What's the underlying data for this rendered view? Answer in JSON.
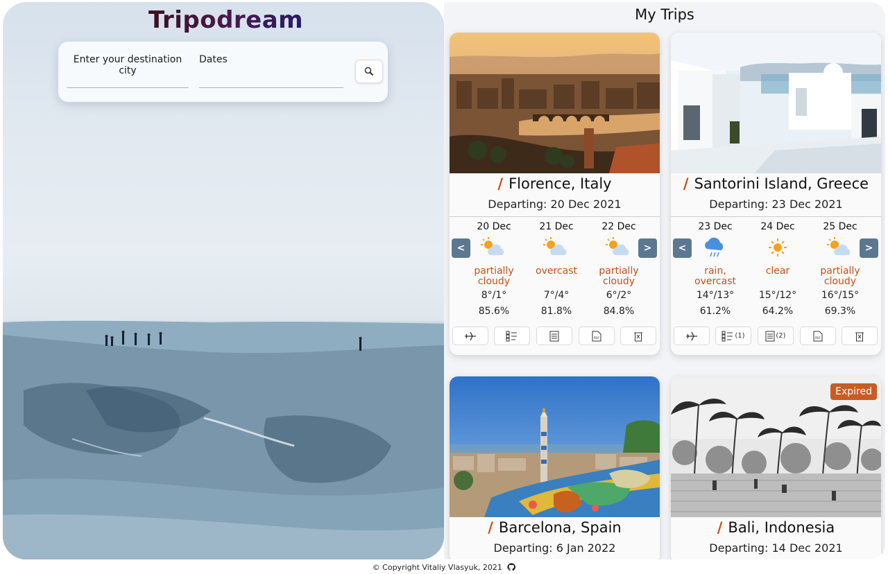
{
  "app": {
    "logo": "Tripodream"
  },
  "search": {
    "destination_label": "Enter your destination city",
    "dates_label": "Dates",
    "search_icon": "magnifier-icon"
  },
  "trips_section": {
    "title": "My Trips"
  },
  "trips": [
    {
      "city": "Florence, Italy",
      "departing": "Departing: 20 Dec 2021",
      "forecast": [
        {
          "date": "20 Dec",
          "icon": "partly-cloudy-icon",
          "condition": "partially cloudy",
          "temp": "8°/1°",
          "humidity": "85.6%"
        },
        {
          "date": "21 Dec",
          "icon": "partly-cloudy-icon",
          "condition": "overcast",
          "temp": "7°/4°",
          "humidity": "81.8%"
        },
        {
          "date": "22 Dec",
          "icon": "partly-cloudy-icon",
          "condition": "partially cloudy",
          "temp": "6°/2°",
          "humidity": "84.8%"
        }
      ],
      "actions": [
        {
          "icon": "plane-icon",
          "count": ""
        },
        {
          "icon": "checklist-icon",
          "count": ""
        },
        {
          "icon": "notes-icon",
          "count": ""
        },
        {
          "icon": "pdf-icon",
          "count": ""
        },
        {
          "icon": "delete-icon",
          "count": ""
        }
      ]
    },
    {
      "city": "Santorini Island, Greece",
      "departing": "Departing: 23 Dec 2021",
      "forecast": [
        {
          "date": "23 Dec",
          "icon": "rain-icon",
          "condition": "rain, overcast",
          "temp": "14°/13°",
          "humidity": "61.2%"
        },
        {
          "date": "24 Dec",
          "icon": "sun-icon",
          "condition": "clear",
          "temp": "15°/12°",
          "humidity": "64.2%"
        },
        {
          "date": "25 Dec",
          "icon": "partly-cloudy-icon",
          "condition": "partially cloudy",
          "temp": "16°/15°",
          "humidity": "69.3%"
        }
      ],
      "actions": [
        {
          "icon": "plane-icon",
          "count": ""
        },
        {
          "icon": "checklist-icon",
          "count": "(1)"
        },
        {
          "icon": "notes-icon",
          "count": "(2)"
        },
        {
          "icon": "pdf-icon",
          "count": ""
        },
        {
          "icon": "delete-icon",
          "count": ""
        }
      ]
    },
    {
      "city": "Barcelona, Spain",
      "departing": "Departing: 6 Jan 2022"
    },
    {
      "city": "Bali, Indonesia",
      "departing": "Departing: 14 Dec 2021",
      "badge": "Expired"
    }
  ],
  "nav": {
    "prev": "<",
    "next": ">"
  },
  "footer": {
    "copyright": "© Copyright Vitaliy Vlasyuk, 2021"
  }
}
